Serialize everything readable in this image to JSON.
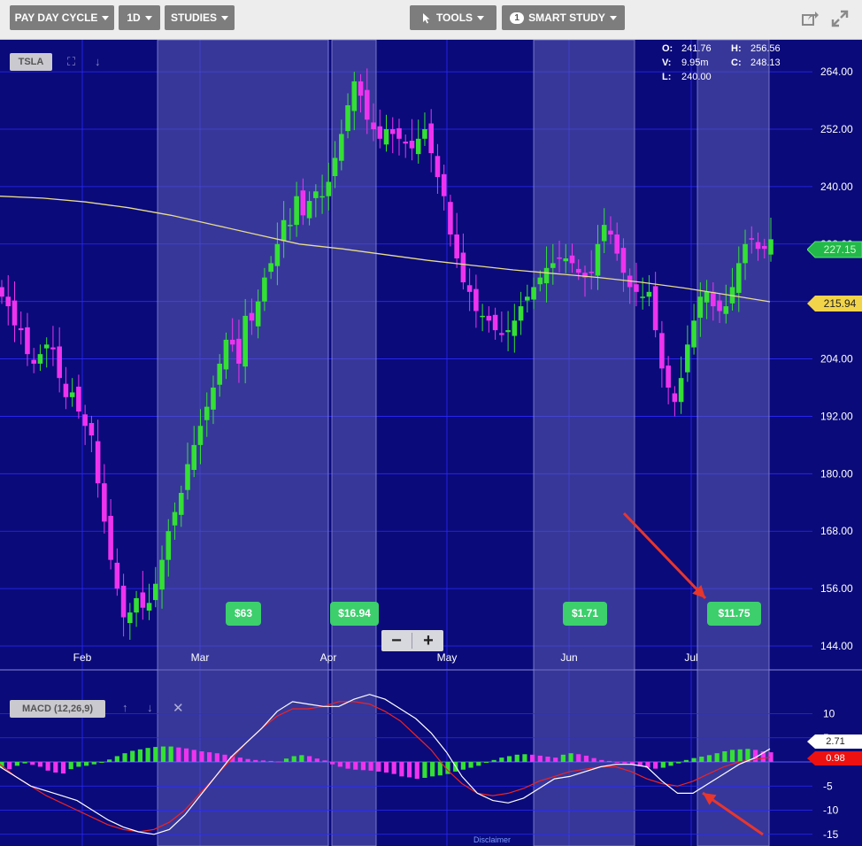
{
  "toolbar": {
    "pay_day_cycle": "PAY DAY CYCLE",
    "interval": "1D",
    "studies": "STUDIES",
    "tools": "TOOLS",
    "smart_study": "SMART STUDY",
    "smart_study_count": "1"
  },
  "symbol": "TSLA",
  "ohlc": {
    "o_label": "O:",
    "o": "241.76",
    "h_label": "H:",
    "h": "256.56",
    "v_label": "V:",
    "v": "9.95m",
    "c_label": "C:",
    "c": "248.13",
    "l_label": "L:",
    "l": "240.00"
  },
  "price_tags": {
    "last": "227.15",
    "ma": "215.94"
  },
  "profits": [
    "$63",
    "$16.94",
    "$1.71",
    "$11.75"
  ],
  "zoom": {
    "minus": "−",
    "plus": "+"
  },
  "macd_label": "MACD (12,26,9)",
  "macd_tags": {
    "macd": "2.71",
    "signal": "0.98"
  },
  "footer_link": "Disclaimer",
  "colors": {
    "background": "#0a0a7a",
    "up": "#33e033",
    "down": "#ee33ee",
    "ma_line": "#e8dc8a",
    "highlight": "#5d5db4",
    "profit": "#3ccf6c",
    "arrow": "#e8362c"
  },
  "chart_data": [
    {
      "type": "candlestick",
      "title": "TSLA",
      "x_ticks": [
        "Feb",
        "Mar",
        "Apr",
        "May",
        "Jun",
        "Jul"
      ],
      "y_ticks": [
        144,
        156,
        168,
        180,
        192,
        204,
        216,
        228,
        240,
        252,
        264
      ],
      "ylim": [
        140,
        268
      ],
      "grid": true,
      "series": [
        {
          "name": "price",
          "close": [
            217,
            215,
            211,
            210,
            205,
            203,
            205,
            207,
            206,
            200,
            196,
            197,
            193,
            190,
            188,
            178,
            170,
            162,
            156,
            150,
            151,
            154,
            152,
            153,
            157,
            162,
            168,
            172,
            176,
            182,
            186,
            190,
            194,
            198,
            203,
            208,
            207,
            203,
            213,
            212,
            216,
            221,
            224,
            228,
            233,
            232,
            238,
            234,
            237,
            239,
            238,
            241,
            246,
            251,
            257,
            262,
            259,
            254,
            252,
            250,
            252,
            251,
            250,
            249,
            248,
            250,
            252,
            247,
            242,
            238,
            230,
            225,
            220,
            218,
            214,
            213,
            212,
            210,
            209,
            210,
            212,
            215,
            217,
            219,
            221,
            223,
            224,
            225,
            225,
            224,
            222,
            221,
            222,
            228,
            232,
            230,
            226,
            222,
            219,
            218,
            217,
            218,
            210,
            202,
            198,
            195,
            200,
            207,
            212,
            217,
            218,
            215,
            214,
            215,
            219,
            224,
            228,
            229,
            227,
            227,
            229
          ]
        },
        {
          "name": "moving average",
          "values": [
            238,
            237.6,
            236.8,
            235.6,
            234,
            232,
            230,
            228,
            227,
            225.8,
            224.6,
            223.6,
            222.6,
            221.8,
            221,
            220,
            218.8,
            217.4,
            215.94
          ]
        }
      ]
    },
    {
      "type": "macd",
      "title": "MACD (12,26,9)",
      "y_ticks": [
        10,
        5,
        0,
        -5,
        -10,
        -15
      ],
      "ylim": [
        -16,
        12
      ],
      "series": [
        {
          "name": "MACD",
          "values": [
            -1,
            -3,
            -5,
            -6,
            -7,
            -8,
            -10,
            -12,
            -13.5,
            -14.5,
            -15,
            -14,
            -11,
            -7,
            -3,
            1,
            4,
            7,
            10.5,
            12.5,
            12,
            11.5,
            11.5,
            13,
            14,
            13,
            11,
            9,
            6,
            2,
            -3,
            -6.5,
            -8,
            -8.5,
            -7.5,
            -5.5,
            -3.5,
            -3,
            -2,
            -1,
            -0.5,
            -0.5,
            -1,
            -4,
            -6.5,
            -6.5,
            -4.5,
            -2.5,
            -0.5,
            0.8,
            2.71
          ]
        },
        {
          "name": "Signal",
          "values": [
            -0.5,
            -3,
            -5,
            -7,
            -8.5,
            -10,
            -11.5,
            -13,
            -14,
            -14.5,
            -14,
            -12.5,
            -10,
            -6.5,
            -3,
            0.5,
            4,
            7,
            9.5,
            11,
            11,
            11.5,
            12.5,
            12.5,
            12,
            10.5,
            8.5,
            5.5,
            2.5,
            -1.5,
            -4.5,
            -6.5,
            -7,
            -6.5,
            -5.5,
            -4,
            -3,
            -2,
            -1.5,
            -1,
            -1,
            -2,
            -3.5,
            -4.5,
            -5,
            -4,
            -2.5,
            -1,
            0,
            0.5,
            0.98
          ]
        },
        {
          "name": "Histogram",
          "values": [
            -1.2,
            -1.5,
            -0.8,
            -0.3,
            -0.6,
            -1,
            -1.8,
            -2.2,
            -2.4,
            -1.5,
            -1,
            -0.8,
            -0.5,
            0,
            0.5,
            1.2,
            1.8,
            2.3,
            2.6,
            2.9,
            3.1,
            3.2,
            3.2,
            3,
            2.8,
            2.5,
            2.2,
            2,
            1.8,
            1.5,
            1.2,
            0.9,
            0.6,
            0.4,
            0.3,
            0.2,
            0.1,
            0.7,
            1.2,
            1.4,
            1.2,
            0.7,
            0.3,
            -0.5,
            -1,
            -1.4,
            -1.6,
            -1.7,
            -1.8,
            -2,
            -2.2,
            -2.5,
            -3,
            -3.2,
            -3.5,
            -3.3,
            -3,
            -2.8,
            -2.5,
            -2,
            -1.6,
            -1.2,
            -0.8,
            -0.2,
            0.4,
            0.9,
            1.2,
            1.5,
            1.6,
            1.5,
            1.3,
            1.1,
            0.9,
            1.5,
            1.8,
            1.6,
            1.3,
            0.8,
            0.4,
            0.2,
            0,
            -0.3,
            -0.6,
            -0.9,
            -1.2,
            -1.4,
            -1.2,
            -0.8,
            -0.3,
            0.4,
            0.8,
            1.1,
            1.4,
            1.8,
            2.2,
            2.5,
            2.6,
            2.7,
            2.5,
            2.2,
            2
          ]
        }
      ]
    }
  ]
}
